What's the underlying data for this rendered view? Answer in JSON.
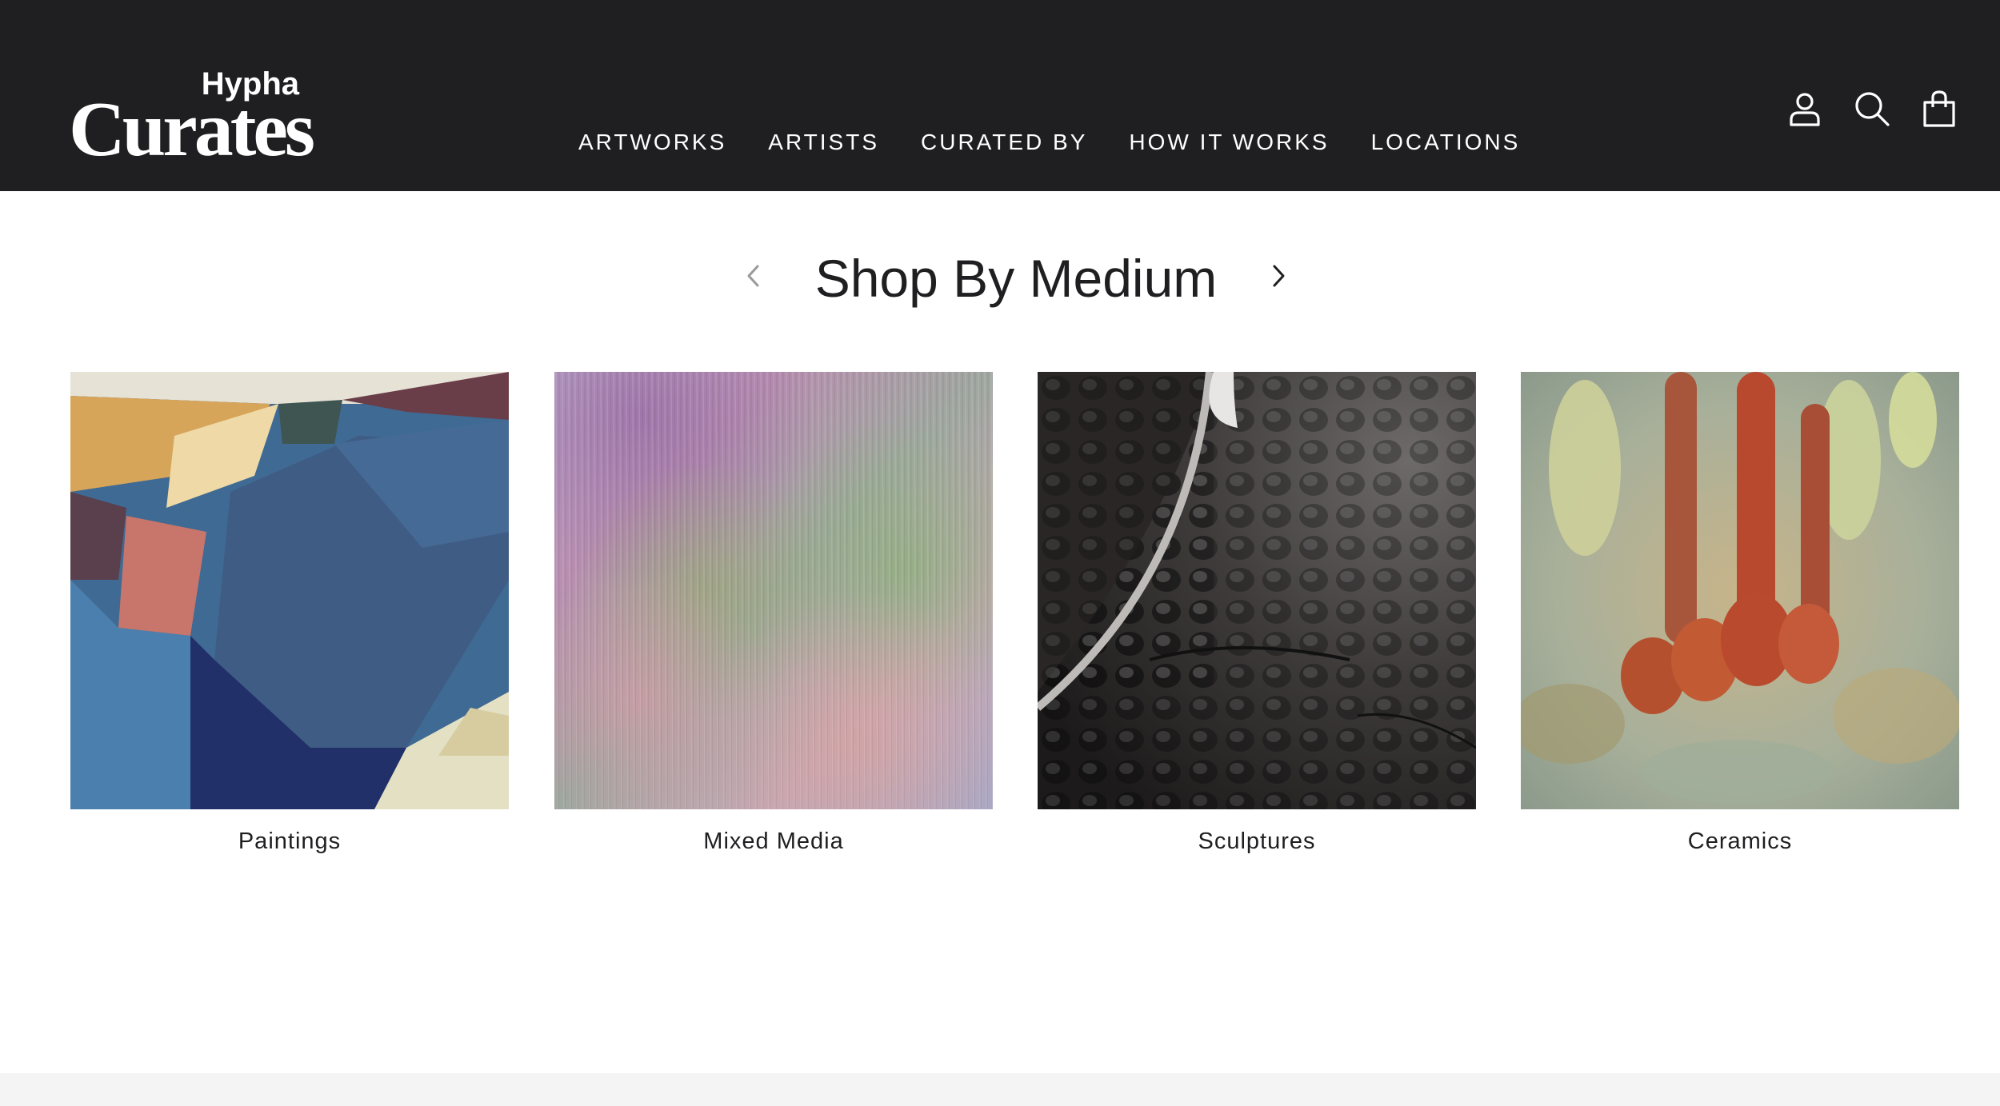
{
  "brand": {
    "logo_top": "Hypha",
    "logo_main": "Curates"
  },
  "nav": {
    "items": [
      {
        "label": "ARTWORKS"
      },
      {
        "label": "ARTISTS"
      },
      {
        "label": "CURATED BY"
      },
      {
        "label": "HOW IT WORKS"
      },
      {
        "label": "LOCATIONS"
      }
    ]
  },
  "header_icons": [
    "account-icon",
    "search-icon",
    "cart-icon"
  ],
  "section": {
    "title": "Shop By Medium",
    "cards": [
      {
        "label": "Paintings"
      },
      {
        "label": "Mixed Media"
      },
      {
        "label": "Sculptures"
      },
      {
        "label": "Ceramics"
      }
    ]
  },
  "colors": {
    "header_bg": "#1f1f21",
    "text": "#1f1f21",
    "arrow_disabled": "#9a9a9a"
  }
}
